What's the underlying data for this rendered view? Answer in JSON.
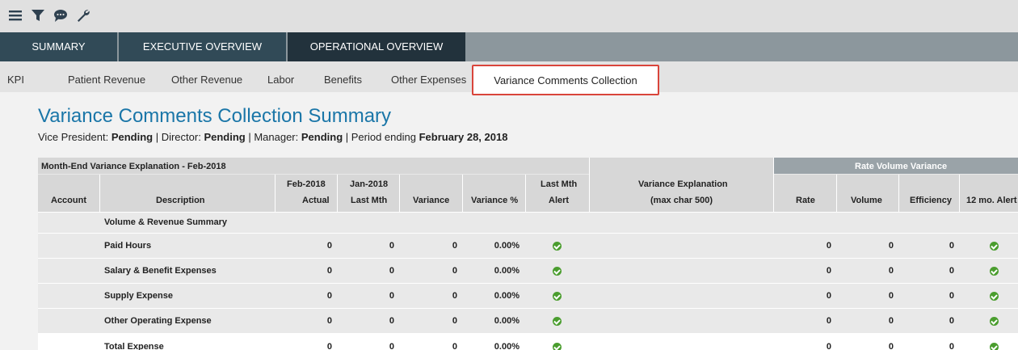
{
  "toolbar": {
    "icons": [
      "menu-icon",
      "filter-icon",
      "comment-icon",
      "wrench-icon"
    ]
  },
  "nav_primary": {
    "tabs": [
      {
        "label": "SUMMARY"
      },
      {
        "label": "EXECUTIVE OVERVIEW"
      },
      {
        "label": "OPERATIONAL OVERVIEW"
      }
    ]
  },
  "nav_secondary": {
    "tabs": [
      {
        "label": "KPI"
      },
      {
        "label": "Patient Revenue"
      },
      {
        "label": "Other Revenue"
      },
      {
        "label": "Labor"
      },
      {
        "label": "Benefits"
      },
      {
        "label": "Other Expenses"
      },
      {
        "label": "Variance Comments Collection"
      }
    ]
  },
  "page": {
    "title": "Variance Comments Collection Summary",
    "vp_label": "Vice President: ",
    "vp_value": "Pending",
    "dir_label": " | Director: ",
    "dir_value": "Pending",
    "mgr_label": " | Manager: ",
    "mgr_value": "Pending",
    "period_label": " | Period ending ",
    "period_value": "February 28, 2018"
  },
  "table": {
    "caption": "Month-End Variance Explanation - Feb-2018",
    "group_header": "Rate Volume Variance",
    "headers": {
      "account": "Account",
      "description": "Description",
      "feb_1": "Feb-2018",
      "feb_2": "Actual",
      "jan_1": "Jan-2018",
      "jan_2": "Last Mth",
      "variance": "Variance",
      "variance_pct": "Variance %",
      "alert_1": "Last Mth",
      "alert_2": "Alert",
      "expl_1": "Variance Explanation",
      "expl_2": "(max char 500)",
      "rate": "Rate",
      "volume": "Volume",
      "efficiency": "Efficiency",
      "alert12": "12 mo. Alert"
    },
    "section": "Volume & Revenue Summary",
    "rows": [
      {
        "description": "Paid Hours",
        "actual": "0",
        "last_mth": "0",
        "variance": "0",
        "variance_pct": "0.00%",
        "rate": "0",
        "volume": "0",
        "efficiency": "0"
      },
      {
        "description": "Salary & Benefit Expenses",
        "actual": "0",
        "last_mth": "0",
        "variance": "0",
        "variance_pct": "0.00%",
        "rate": "0",
        "volume": "0",
        "efficiency": "0"
      },
      {
        "description": "Supply Expense",
        "actual": "0",
        "last_mth": "0",
        "variance": "0",
        "variance_pct": "0.00%",
        "rate": "0",
        "volume": "0",
        "efficiency": "0"
      },
      {
        "description": "Other Operating Expense",
        "actual": "0",
        "last_mth": "0",
        "variance": "0",
        "variance_pct": "0.00%",
        "rate": "0",
        "volume": "0",
        "efficiency": "0"
      },
      {
        "description": "Total Expense",
        "actual": "0",
        "last_mth": "0",
        "variance": "0",
        "variance_pct": "0.00%",
        "rate": "0",
        "volume": "0",
        "efficiency": "0"
      }
    ],
    "status_color": "#4a9d2e"
  },
  "colors": {
    "nav_dark": "#314a57",
    "nav_active": "#22323c",
    "title_blue": "#1a76a8",
    "highlight_red": "#d9453b"
  }
}
